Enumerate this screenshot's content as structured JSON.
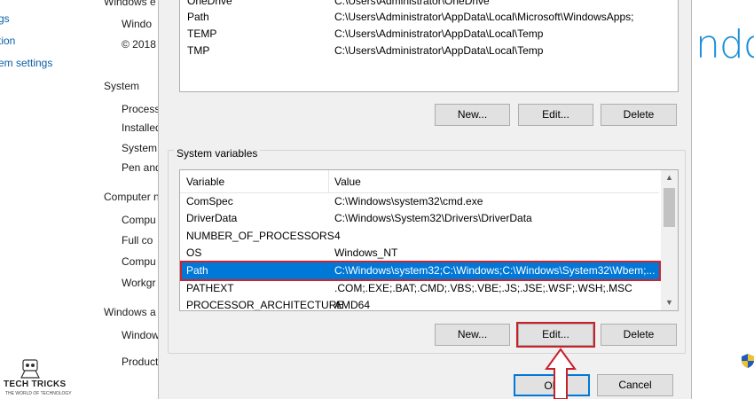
{
  "background": {
    "left_items": [
      {
        "text": "gs",
        "kind": "link"
      },
      {
        "text": "tion",
        "kind": "link"
      },
      {
        "text": "em settings",
        "kind": "link"
      },
      {
        "text": "Windows e",
        "kind": "head"
      },
      {
        "text": "Windo",
        "kind": "text"
      },
      {
        "text": "© 2018",
        "kind": "text"
      },
      {
        "text": "System",
        "kind": "head"
      },
      {
        "text": "Process",
        "kind": "text"
      },
      {
        "text": "Installed",
        "kind": "text"
      },
      {
        "text": "System",
        "kind": "text"
      },
      {
        "text": "Pen and",
        "kind": "text"
      },
      {
        "text": "Computer n",
        "kind": "head"
      },
      {
        "text": "Compu",
        "kind": "text"
      },
      {
        "text": "Full co",
        "kind": "text"
      },
      {
        "text": "Compu",
        "kind": "text"
      },
      {
        "text": "Workgr",
        "kind": "text"
      },
      {
        "text": "Windows a",
        "kind": "head"
      },
      {
        "text": "Window",
        "kind": "text"
      },
      {
        "text": "Product",
        "kind": "text"
      }
    ],
    "windows_brand": "ndo",
    "watermark": {
      "name": "TECH TRICKS",
      "tagline": "THE WORLD OF TECHNOLOGY"
    }
  },
  "user_variables": {
    "rows": [
      {
        "variable": "OneDrive",
        "value": "C:\\Users\\Administrator\\OneDrive"
      },
      {
        "variable": "Path",
        "value": "C:\\Users\\Administrator\\AppData\\Local\\Microsoft\\WindowsApps;"
      },
      {
        "variable": "TEMP",
        "value": "C:\\Users\\Administrator\\AppData\\Local\\Temp"
      },
      {
        "variable": "TMP",
        "value": "C:\\Users\\Administrator\\AppData\\Local\\Temp"
      }
    ],
    "buttons": {
      "new": "New...",
      "edit": "Edit...",
      "delete": "Delete"
    }
  },
  "system_variables": {
    "label": "System variables",
    "headers": {
      "variable": "Variable",
      "value": "Value"
    },
    "rows": [
      {
        "variable": "ComSpec",
        "value": "C:\\Windows\\system32\\cmd.exe"
      },
      {
        "variable": "DriverData",
        "value": "C:\\Windows\\System32\\Drivers\\DriverData"
      },
      {
        "variable": "NUMBER_OF_PROCESSORS",
        "value": "4"
      },
      {
        "variable": "OS",
        "value": "Windows_NT"
      },
      {
        "variable": "Path",
        "value": "C:\\Windows\\system32;C:\\Windows;C:\\Windows\\System32\\Wbem;..."
      },
      {
        "variable": "PATHEXT",
        "value": ".COM;.EXE;.BAT;.CMD;.VBS;.VBE;.JS;.JSE;.WSF;.WSH;.MSC"
      },
      {
        "variable": "PROCESSOR_ARCHITECTURE",
        "value": "AMD64"
      }
    ],
    "selected_index": 4,
    "buttons": {
      "new": "New...",
      "edit": "Edit...",
      "delete": "Delete"
    }
  },
  "dialog_buttons": {
    "ok": "OK",
    "cancel": "Cancel"
  },
  "colors": {
    "selection": "#0078d7",
    "highlight_red": "#c8202a",
    "brand_blue": "#1a8fd8"
  }
}
